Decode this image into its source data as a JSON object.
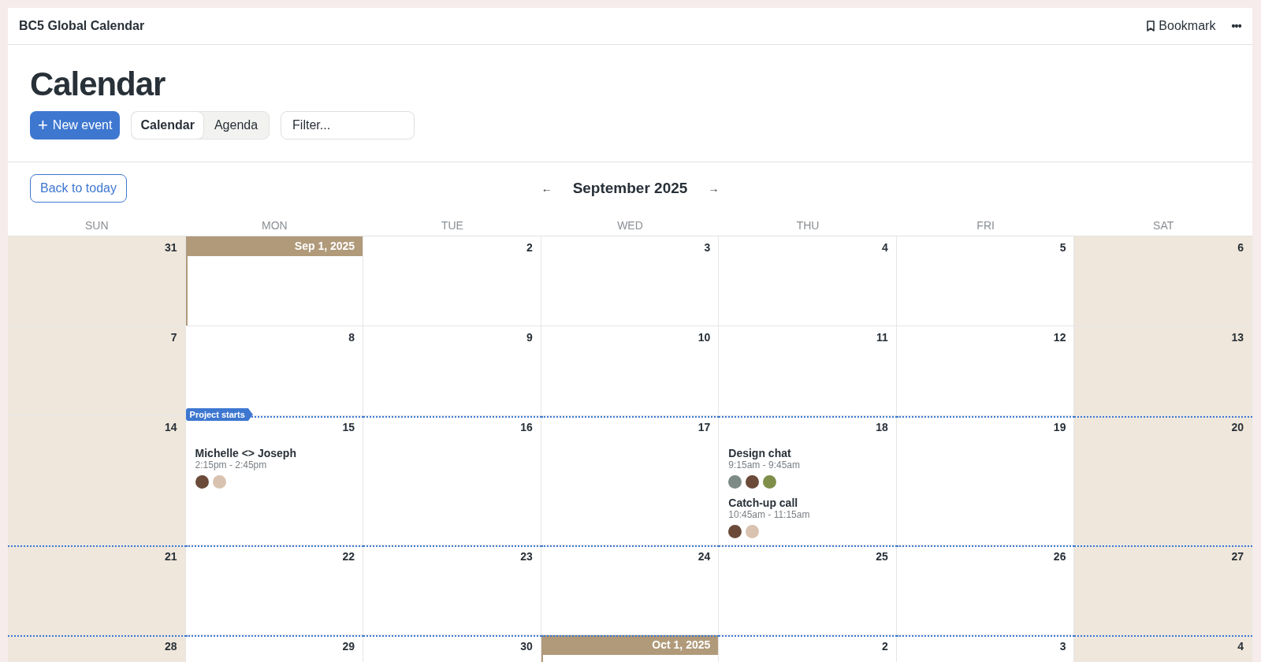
{
  "header": {
    "title": "BC5 Global Calendar",
    "bookmark": "Bookmark",
    "more": "•••"
  },
  "page_title": "Calendar",
  "new_event": {
    "icon": "+",
    "label": "New event"
  },
  "views": [
    {
      "label": "Calendar",
      "selected": true
    },
    {
      "label": "Agenda",
      "selected": false
    }
  ],
  "filter": {
    "placeholder": "Filter..."
  },
  "back_to_today": "Back to today",
  "nav": {
    "prev": "←",
    "month": "September 2025",
    "next": "→"
  },
  "weekdays": [
    "SUN",
    "MON",
    "TUE",
    "WED",
    "THU",
    "FRI",
    "SAT"
  ],
  "weeks": [
    {
      "days": [
        {
          "label": "31",
          "weekend": true,
          "in_project": false
        },
        {
          "label": "Sep 1, 2025",
          "weekend": false,
          "in_project": false,
          "month_start": true
        },
        {
          "label": "2",
          "weekend": false,
          "in_project": false
        },
        {
          "label": "3",
          "weekend": false,
          "in_project": false
        },
        {
          "label": "4",
          "weekend": false,
          "in_project": false
        },
        {
          "label": "5",
          "weekend": false,
          "in_project": false
        },
        {
          "label": "6",
          "weekend": true,
          "in_project": false
        }
      ]
    },
    {
      "days": [
        {
          "label": "7",
          "weekend": true,
          "in_project": false
        },
        {
          "label": "8",
          "weekend": false,
          "in_project": false
        },
        {
          "label": "9",
          "weekend": false,
          "in_project": false
        },
        {
          "label": "10",
          "weekend": false,
          "in_project": false
        },
        {
          "label": "11",
          "weekend": false,
          "in_project": false
        },
        {
          "label": "12",
          "weekend": false,
          "in_project": false
        },
        {
          "label": "13",
          "weekend": true,
          "in_project": false
        }
      ]
    },
    {
      "days": [
        {
          "label": "14",
          "weekend": true,
          "in_project": false
        },
        {
          "label": "15",
          "weekend": false,
          "in_project": true,
          "milestone": "Project starts",
          "events": [
            {
              "title": "Michelle <> Joseph",
              "time": "2:15pm - 2:45pm",
              "attendees": [
                {
                  "color": "#6b4a3a"
                },
                {
                  "color": "#d9c2b0"
                }
              ]
            }
          ]
        },
        {
          "label": "16",
          "weekend": false,
          "in_project": true
        },
        {
          "label": "17",
          "weekend": false,
          "in_project": true
        },
        {
          "label": "18",
          "weekend": false,
          "in_project": true,
          "events": [
            {
              "title": "Design chat",
              "time": "9:15am - 9:45am",
              "attendees": [
                {
                  "color": "#7d8a86"
                },
                {
                  "color": "#6b4a3a"
                },
                {
                  "color": "#7f8f4a"
                }
              ]
            },
            {
              "title": "Catch-up call",
              "time": "10:45am - 11:15am",
              "attendees": [
                {
                  "color": "#6b4a3a"
                },
                {
                  "color": "#d9c2b0"
                }
              ]
            }
          ]
        },
        {
          "label": "19",
          "weekend": false,
          "in_project": true
        },
        {
          "label": "20",
          "weekend": true,
          "in_project": true
        }
      ]
    },
    {
      "days": [
        {
          "label": "21",
          "weekend": true,
          "in_project": true
        },
        {
          "label": "22",
          "weekend": false,
          "in_project": true
        },
        {
          "label": "23",
          "weekend": false,
          "in_project": true
        },
        {
          "label": "24",
          "weekend": false,
          "in_project": true
        },
        {
          "label": "25",
          "weekend": false,
          "in_project": true
        },
        {
          "label": "26",
          "weekend": false,
          "in_project": true
        },
        {
          "label": "27",
          "weekend": true,
          "in_project": true
        }
      ]
    },
    {
      "days": [
        {
          "label": "28",
          "weekend": true,
          "in_project": true
        },
        {
          "label": "29",
          "weekend": false,
          "in_project": true
        },
        {
          "label": "30",
          "weekend": false,
          "in_project": true
        },
        {
          "label": "Oct 1, 2025",
          "weekend": false,
          "in_project": true,
          "month_start": true
        },
        {
          "label": "2",
          "weekend": false,
          "in_project": true
        },
        {
          "label": "3",
          "weekend": false,
          "in_project": true
        },
        {
          "label": "4",
          "weekend": true,
          "in_project": true
        }
      ]
    }
  ]
}
